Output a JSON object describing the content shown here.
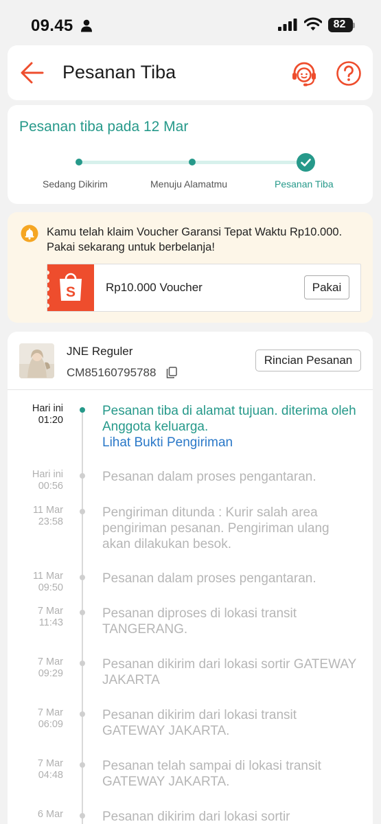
{
  "status_bar": {
    "time": "09.45",
    "battery": "82"
  },
  "header": {
    "title": "Pesanan Tiba"
  },
  "progress": {
    "arrival_text": "Pesanan tiba pada 12 Mar",
    "steps": [
      "Sedang Dikirim",
      "Menuju Alamatmu",
      "Pesanan Tiba"
    ]
  },
  "voucher": {
    "message": "Kamu telah klaim Voucher Garansi Tepat Waktu Rp10.000. Pakai sekarang untuk berbelanja!",
    "amount": "Rp10.000 Voucher",
    "button": "Pakai"
  },
  "shipment": {
    "courier": "JNE Reguler",
    "tracking_number": "CM85160795788",
    "detail_button": "Rincian Pesanan",
    "proof_link": "Lihat Bukti Pengiriman",
    "events": [
      {
        "day": "Hari ini",
        "time": "01:20",
        "text": "Pesanan tiba di alamat tujuan. diterima oleh Anggota keluarga."
      },
      {
        "day": "Hari ini",
        "time": "00:56",
        "text": "Pesanan dalam proses pengantaran."
      },
      {
        "day": "11 Mar",
        "time": "23:58",
        "text": "Pengiriman ditunda : Kurir salah area pengiriman pesanan. Pengiriman ulang akan dilakukan besok."
      },
      {
        "day": "11 Mar",
        "time": "09:50",
        "text": "Pesanan dalam proses pengantaran."
      },
      {
        "day": "7 Mar",
        "time": "11:43",
        "text": "Pesanan diproses di lokasi transit TANGERANG."
      },
      {
        "day": "7 Mar",
        "time": "09:29",
        "text": "Pesanan dikirim dari lokasi sortir GATEWAY JAKARTA"
      },
      {
        "day": "7 Mar",
        "time": "06:09",
        "text": "Pesanan dikirim dari lokasi transit GATEWAY JAKARTA."
      },
      {
        "day": "7 Mar",
        "time": "04:48",
        "text": "Pesanan telah sampai di lokasi transit GATEWAY JAKARTA."
      },
      {
        "day": "6 Mar",
        "time": "",
        "text": "Pesanan dikirim dari lokasi sortir"
      }
    ]
  },
  "icons": {
    "back": "back-arrow-icon",
    "support": "headset-chat-icon",
    "help": "question-circle-icon",
    "bell": "bell-icon",
    "shop": "shopping-bag-icon",
    "copy": "copy-icon"
  },
  "colors": {
    "accent": "#ee4d2d",
    "teal": "#26998a",
    "link": "#2a78c8"
  }
}
